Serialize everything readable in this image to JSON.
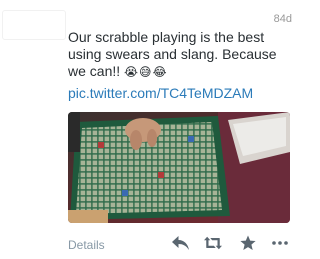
{
  "tweet": {
    "age": "84d",
    "text": "Our scrabble playing is the best using swears and slang. Because we can!!",
    "emojis": "😭😅😂",
    "link": "pic.twitter.com/TC4TeMDZAM"
  },
  "footer": {
    "details_label": "Details"
  },
  "icons": {
    "reply": "reply-icon",
    "retweet": "retweet-icon",
    "favorite": "star-icon",
    "more": "more-dots-icon"
  },
  "colors": {
    "text": "#292f33",
    "link": "#2b7bb9",
    "muted": "#999999",
    "icon": "#5a6670"
  }
}
